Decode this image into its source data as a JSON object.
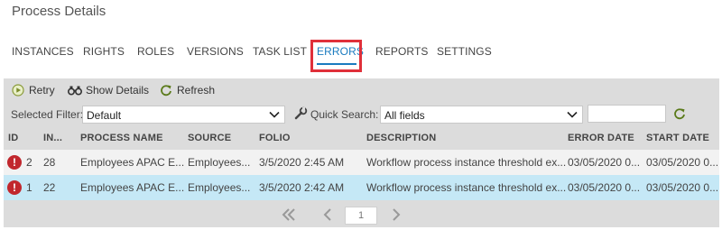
{
  "page": {
    "title": "Process Details"
  },
  "tabs": [
    {
      "label": "INSTANCES"
    },
    {
      "label": "RIGHTS"
    },
    {
      "label": "ROLES"
    },
    {
      "label": "VERSIONS"
    },
    {
      "label": "TASK LIST"
    },
    {
      "label": "ERRORS",
      "active": true
    },
    {
      "label": "REPORTS"
    },
    {
      "label": "SETTINGS"
    }
  ],
  "toolbar": {
    "retry_label": "Retry",
    "show_details_label": "Show Details",
    "refresh_label": "Refresh"
  },
  "filter": {
    "selected_filter_label": "Selected Filter:",
    "selected_filter_value": "Default",
    "quick_search_label": "Quick Search:",
    "quick_search_value": "All fields",
    "search_text": ""
  },
  "columns": [
    "ID",
    "IN...",
    "PROCESS NAME",
    "SOURCE",
    "FOLIO",
    "DESCRIPTION",
    "ERROR DATE",
    "START DATE"
  ],
  "rows": [
    {
      "id": "2",
      "instance": "28",
      "process_name": "Employees APAC E...",
      "source": "Employees...",
      "folio": "3/5/2020 2:45 AM",
      "description": "Workflow process instance threshold ex...",
      "error_date": "03/05/2020 0...",
      "start_date": "03/05/2020 0...",
      "selected": false
    },
    {
      "id": "1",
      "instance": "22",
      "process_name": "Employees APAC E...",
      "source": "Employees...",
      "folio": "3/5/2020 2:42 AM",
      "description": "Workflow process instance threshold ex...",
      "error_date": "03/05/2020 0...",
      "start_date": "03/05/2020 0...",
      "selected": true
    }
  ],
  "pager": {
    "current_page": "1"
  },
  "colors": {
    "accent": "#1a7bbf",
    "highlight": "#e0303a",
    "error": "#c1272d",
    "selected_row": "#c5e8f6"
  },
  "icons": [
    "retry-icon",
    "binoculars-icon",
    "refresh-icon",
    "chevron-down-icon",
    "wrench-icon",
    "error-icon",
    "first-page-icon",
    "prev-page-icon",
    "next-page-icon"
  ]
}
